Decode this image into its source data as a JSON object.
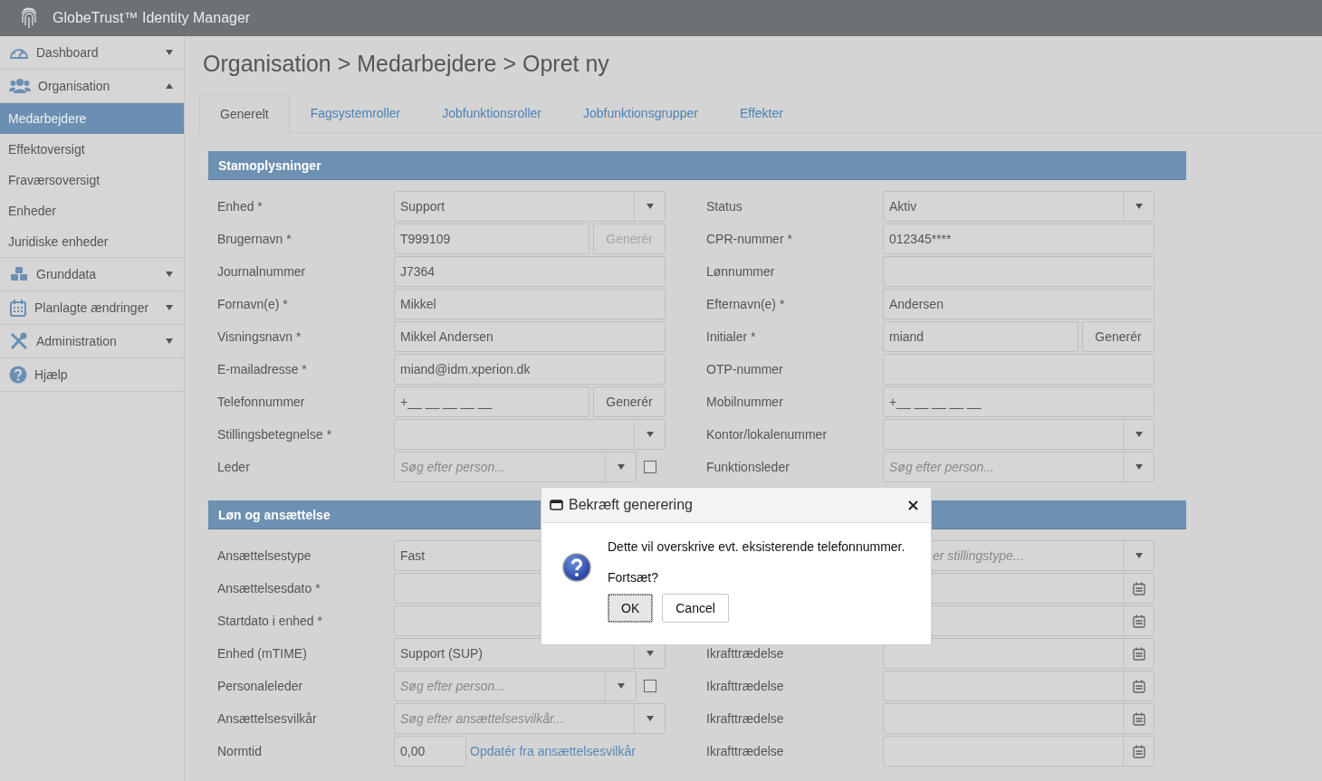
{
  "app": {
    "title": "GlobeTrust™ Identity Manager"
  },
  "sidebar": {
    "items": [
      {
        "label": "Dashboard",
        "expanded": false
      },
      {
        "label": "Organisation",
        "expanded": true,
        "children": [
          {
            "label": "Medarbejdere",
            "selected": true
          },
          {
            "label": "Effektoversigt",
            "selected": false
          },
          {
            "label": "Fraværsoversigt",
            "selected": false
          },
          {
            "label": "Enheder",
            "selected": false
          },
          {
            "label": "Juridiske enheder",
            "selected": false
          }
        ]
      },
      {
        "label": "Grunddata",
        "expanded": false
      },
      {
        "label": "Planlagte ændringer",
        "expanded": false
      },
      {
        "label": "Administration",
        "expanded": false
      },
      {
        "label": "Hjælp"
      }
    ]
  },
  "page": {
    "title": "Organisation > Medarbejdere > Opret ny"
  },
  "tabs": [
    {
      "label": "Generelt",
      "selected": true
    },
    {
      "label": "Fagsystemroller",
      "selected": false
    },
    {
      "label": "Jobfunktionsroller",
      "selected": false
    },
    {
      "label": "Jobfunktionsgrupper",
      "selected": false
    },
    {
      "label": "Effekter",
      "selected": false
    }
  ],
  "sections": [
    {
      "title": "Stamoplysninger",
      "rows": [
        {
          "left": {
            "label": "Enhed *",
            "kind": "select",
            "value": "Support"
          },
          "right": {
            "label": "Status",
            "kind": "select",
            "value": "Aktiv"
          }
        },
        {
          "left": {
            "label": "Brugernavn *",
            "kind": "text_button",
            "value": "T999109",
            "button": {
              "label": "Generér",
              "disabled": true
            }
          },
          "right": {
            "label": "CPR-nummer *",
            "kind": "text",
            "value": "012345****"
          }
        },
        {
          "left": {
            "label": "Journalnummer",
            "kind": "text",
            "value": "J7364"
          },
          "right": {
            "label": "Lønnummer",
            "kind": "text"
          }
        },
        {
          "left": {
            "label": "Fornavn(e) *",
            "kind": "text",
            "value": "Mikkel"
          },
          "right": {
            "label": "Efternavn(e) *",
            "kind": "text",
            "value": "Andersen"
          }
        },
        {
          "left": {
            "label": "Visningsnavn *",
            "kind": "text",
            "value": "Mikkel Andersen"
          },
          "right": {
            "label": "Initialer *",
            "kind": "text_button",
            "value": "miand",
            "button": {
              "label": "Generér",
              "disabled": false
            }
          }
        },
        {
          "left": {
            "label": "E-mailadresse *",
            "kind": "text",
            "value": "miand@idm.xperion.dk"
          },
          "right": {
            "label": "OTP-nummer",
            "kind": "text"
          }
        },
        {
          "left": {
            "label": "Telefonnummer",
            "kind": "text_button",
            "value": "+__ __ __ __ __",
            "button": {
              "label": "Generér",
              "disabled": false
            }
          },
          "right": {
            "label": "Mobilnummer",
            "kind": "text",
            "value": "+__ __ __ __ __"
          }
        },
        {
          "left": {
            "label": "Stillingsbetegnelse *",
            "kind": "select"
          },
          "right": {
            "label": "Kontor/lokalenummer",
            "kind": "select"
          }
        },
        {
          "left": {
            "label": "Leder",
            "kind": "search",
            "placeholder": "Søg efter person...",
            "checked": false
          },
          "right": {
            "label": "Funktionsleder",
            "kind": "select",
            "placeholder": "Søg efter person..."
          }
        }
      ]
    },
    {
      "title": "Løn og ansættelse",
      "rows": [
        {
          "left": {
            "label": "Ansættelsestype",
            "kind": "text",
            "value": "Fast"
          },
          "right": {
            "kind": "select",
            "placeholder": "er stillingstype..."
          }
        },
        {
          "left": {
            "label": "Ansættelsesdato *",
            "kind": "text"
          },
          "right": {
            "kind": "date"
          }
        },
        {
          "left": {
            "label": "Startdato i enhed *",
            "kind": "text"
          },
          "right": {
            "kind": "date"
          }
        },
        {
          "left": {
            "label": "Enhed (mTIME)",
            "kind": "select",
            "value": "Support (SUP)"
          },
          "right": {
            "label": "Ikrafttrædelse",
            "kind": "date"
          }
        },
        {
          "left": {
            "label": "Personaleleder",
            "kind": "search",
            "placeholder": "Søg efter person...",
            "checked": false
          },
          "right": {
            "label": "Ikrafttrædelse",
            "kind": "date"
          }
        },
        {
          "left": {
            "label": "Ansættelsesvilkår",
            "kind": "select",
            "placeholder": "Søg efter ansættelsesvilkår..."
          },
          "right": {
            "label": "Ikrafttrædelse",
            "kind": "date"
          }
        },
        {
          "left": {
            "label": "Normtid",
            "kind": "short_link",
            "value": "0,00",
            "link": "Opdatér fra ansættelsesvilkår"
          },
          "right": {
            "label": "Ikrafttrædelse",
            "kind": "date"
          }
        }
      ]
    }
  ],
  "dialog": {
    "title": "Bekræft generering",
    "message": "Dette vil overskrive evt. eksisterende telefonnummer.",
    "question": "Fortsæt?",
    "buttons": [
      "OK",
      "Cancel"
    ]
  }
}
